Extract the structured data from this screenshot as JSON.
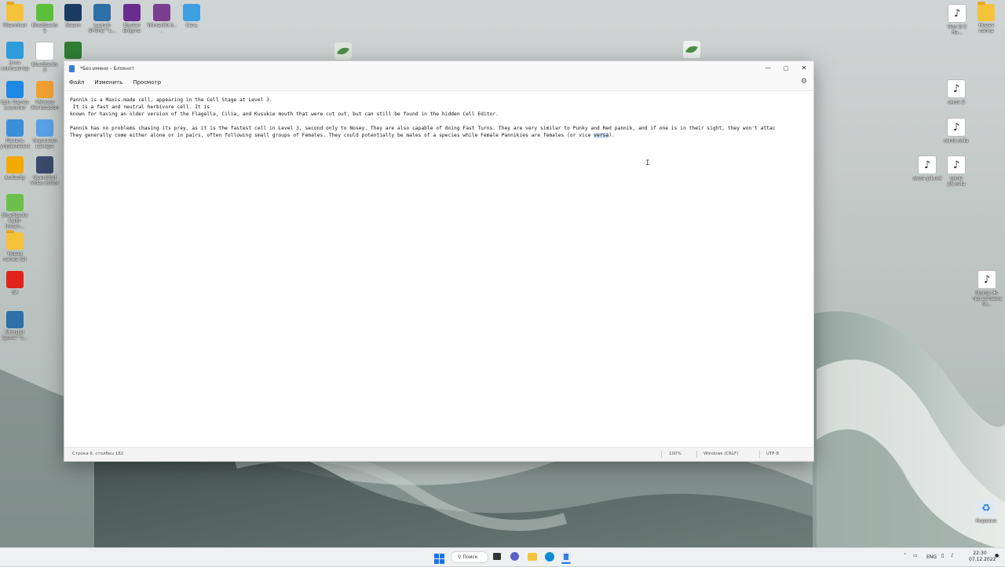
{
  "desktop": {
    "left_icons": [
      {
        "label": "95anniver",
        "kind": "folder",
        "color": "#f6c23a"
      },
      {
        "label": "BlueStacks 5",
        "kind": "app",
        "color": "#5cbf3a"
      },
      {
        "label": "Steam",
        "kind": "app",
        "color": "#1b3b63"
      },
      {
        "label": "Launch SPORE™s...",
        "kind": "app",
        "color": "#2d6fa8"
      },
      {
        "label": "Elysian Enigma",
        "kind": "app",
        "color": "#6b2c8f"
      },
      {
        "label": "Winrar50.b...",
        "kind": "app",
        "color": "#7a3e8f"
      },
      {
        "label": "Сеть",
        "kind": "app",
        "color": "#3da0e0"
      },
      {
        "label": "Этот компьютер",
        "kind": "app",
        "color": "#2d9cdb"
      },
      {
        "label": "BlueStacks X",
        "kind": "file",
        "color": "#ffffff"
      },
      {
        "label": "",
        "kind": "app",
        "color": "#2f7d32"
      },
      {
        "label": "Epic Games Launcher",
        "kind": "app",
        "color": "#1e88e5"
      },
      {
        "label": "VMware Workstation",
        "kind": "app",
        "color": "#f0a030"
      },
      {
        "label": "Панель управления",
        "kind": "app",
        "color": "#3b8fd9"
      },
      {
        "label": "Экранная камера",
        "kind": "app",
        "color": "#5aa0e6"
      },
      {
        "label": "Audacity",
        "kind": "app",
        "color": "#f2a900"
      },
      {
        "label": "OpenShot Video Editor",
        "kind": "app",
        "color": "#3a4a6a"
      },
      {
        "label": "BlueStacks Multi-Instan...",
        "kind": "app",
        "color": "#6cc04a"
      },
      {
        "label": "Новая папка (2)",
        "kind": "folder",
        "color": "#f6c23a"
      },
      {
        "label": "EA",
        "kind": "app",
        "color": "#e2231a"
      },
      {
        "label": "Monster Spore™s...",
        "kind": "app",
        "color": "#2d6fa8"
      }
    ],
    "right_icons": [
      {
        "label": "Пол В-3 На...",
        "kind": "file"
      },
      {
        "label": "Новая папка",
        "kind": "folder"
      },
      {
        "label": "омлн 9",
        "kind": "file"
      },
      {
        "label": "омлн.m4a",
        "kind": "file"
      },
      {
        "label": "омлн p4.m4",
        "kind": "file"
      },
      {
        "label": "омлн p5.m4a",
        "kind": "file"
      },
      {
        "label": "Stomp Ж-тер вставка (и...",
        "kind": "file"
      },
      {
        "label": "Корзина",
        "kind": "app"
      }
    ]
  },
  "notepad": {
    "title": "*Без имени – Блокнот",
    "menu": [
      "Файл",
      "Изменить",
      "Просмотр"
    ],
    "lines": [
      "Pannik is a Maxis-made cell, appearing in the Cell Stage at Level 3.",
      " It is a fast and neutral herbivore cell. It is",
      "known for having an older version of the Flagella, Cilia, and Kusukie mouth that were cut out, but can still be found in the hidden Cell Editor.",
      "",
      "Pannik has no problems chasing its prey, as it is the fastest cell in Level 3, second only to Nosey. They are also capable of doing Fast Turns. They are very similar to Punky and Red pannik, and if one is in their sight, they won't attac"
    ],
    "last_line_before": "They generally come either alone or in pairs, often following small groups of Females. They could potentially be males of a species while Female Pannikies are females (or vice ",
    "last_line_selected": "versa",
    "last_line_after": ").",
    "status": {
      "position": "Строка 6, столбец 182",
      "zoom": "100%",
      "line_ending": "Windows (CRLF)",
      "encoding": "UTF-8"
    }
  },
  "taskbar": {
    "search_label": "Поиск",
    "lang": "ENG",
    "time": "22:30",
    "date": "07.12.2022"
  }
}
